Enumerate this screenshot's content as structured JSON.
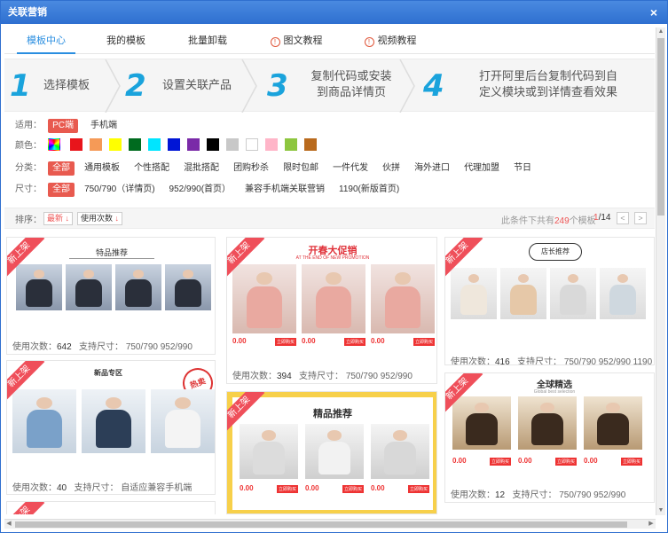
{
  "window": {
    "title": "关联营销",
    "close_glyph": "×"
  },
  "tabs": [
    {
      "label": "模板中心"
    },
    {
      "label": "我的模板"
    },
    {
      "label": "批量卸载"
    },
    {
      "label": "图文教程",
      "icon": "info-icon"
    },
    {
      "label": "视频教程",
      "icon": "info-icon"
    }
  ],
  "steps": [
    {
      "num": "1",
      "text": "选择模板"
    },
    {
      "num": "2",
      "text": "设置关联产品"
    },
    {
      "num": "3",
      "line1": "复制代码或安装",
      "line2": "到商品详情页"
    },
    {
      "num": "4",
      "line1": "打开阿里后台复制代码到自",
      "line2": "定义模块或到详情查看效果"
    }
  ],
  "filters": {
    "platform": {
      "label": "适用：",
      "options": [
        "PC端",
        "手机端"
      ]
    },
    "color": {
      "label": "颜色：",
      "swatches": [
        "#ffffff",
        "#e8151b",
        "#f59a57",
        "#ffff00",
        "#006b1f",
        "#00e5ff",
        "#0015d6",
        "#7a2aa8",
        "#000000",
        "#c8c8c8",
        "#ffffff",
        "#ffb5c8",
        "#8dc63f",
        "#b96a1d"
      ]
    },
    "category": {
      "label": "分类：",
      "options": [
        "全部",
        "通用模板",
        "个性搭配",
        "混批搭配",
        "团购秒杀",
        "限时包邮",
        "一件代发",
        "伙拼",
        "海外进口",
        "代理加盟",
        "节日"
      ]
    },
    "size": {
      "label": "尺寸：",
      "options": [
        "全部",
        "750/790（详情页)",
        "952/990(首页）",
        "兼容手机端关联营销",
        "1190(新版首页)"
      ]
    }
  },
  "sortbar": {
    "label": "排序：",
    "latest": "最新",
    "usage": "使用次数",
    "arrow": "↓",
    "total_prefix": "此条件下共有",
    "total_count": "249",
    "total_suffix": "个模板",
    "page_current": "1",
    "page_total": "/14",
    "prev": "<",
    "next": ">"
  },
  "cards": [
    {
      "ribbon": "新上架",
      "banner": "特品推荐",
      "uses_label": "使用次数：",
      "uses": "642",
      "sizes_label": "支持尺寸：",
      "sizes": "750/790    952/990"
    },
    {
      "ribbon": "新上架",
      "banner": "开春大促销",
      "banner_sub": "AT THE END OF NEW PROMOTION",
      "uses_label": "使用次数：",
      "uses": "394",
      "sizes_label": "支持尺寸：",
      "sizes": "750/790    952/990"
    },
    {
      "ribbon": "新上架",
      "banner": "店长推荐",
      "uses_label": "使用次数：",
      "uses": "416",
      "sizes_label": "支持尺寸：",
      "sizes": "750/790    952/990    1190"
    },
    {
      "ribbon": "新上架",
      "banner": "新品专区",
      "stamp": "热卖",
      "uses_label": "使用次数：",
      "uses": "40",
      "sizes_label": "支持尺寸：",
      "sizes": "自适应兼容手机端"
    },
    {
      "ribbon": "新上架",
      "banner": "精品推荐",
      "uses_label": "",
      "uses": "",
      "sizes_label": "",
      "sizes": ""
    },
    {
      "ribbon": "新上架",
      "banner": "全球精选",
      "banner_sub": "Global best selection",
      "uses_label": "使用次数：",
      "uses": "12",
      "sizes_label": "支持尺寸：",
      "sizes": "750/790    952/990"
    },
    {
      "ribbon": "新上架",
      "banner": "",
      "uses_label": "",
      "uses": "",
      "sizes_label": "",
      "sizes": ""
    }
  ],
  "prices": {
    "zero": "0.00",
    "buy": "立即购买"
  }
}
